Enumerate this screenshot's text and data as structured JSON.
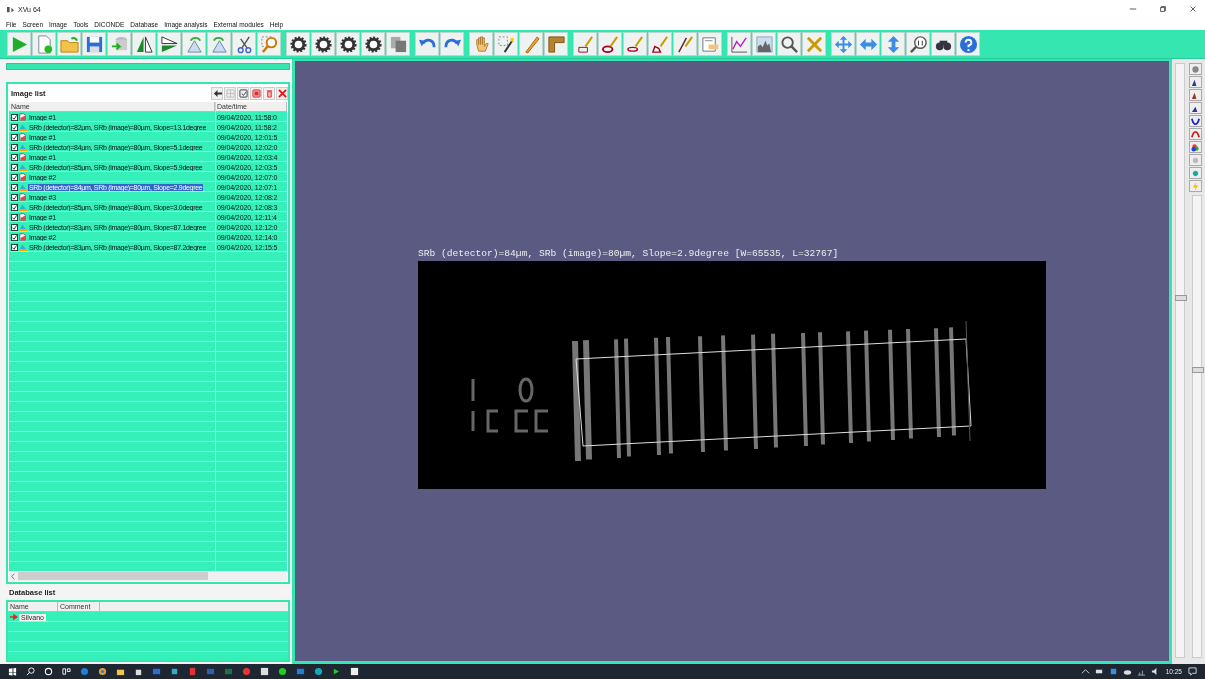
{
  "window": {
    "title": "XVu 64"
  },
  "menu": [
    "File",
    "Screen",
    "Image",
    "Tools",
    "DICONDE",
    "Database",
    "Image analysis",
    "External modules",
    "Help"
  ],
  "image_list": {
    "title": "Image list",
    "columns": [
      "Name",
      "Date/time"
    ],
    "rows": [
      {
        "kind": "image",
        "name": "Image #1",
        "date": "09/04/2020, 11:58:0",
        "checked": true,
        "selected": false
      },
      {
        "kind": "result",
        "name": "SRb (detector)=82µm, SRb (image)=80µm, Slope=13.1degree",
        "date": "09/04/2020, 11:58:2",
        "checked": true,
        "selected": false
      },
      {
        "kind": "image",
        "name": "Image #1",
        "date": "09/04/2020, 12:01:5",
        "checked": true,
        "selected": false
      },
      {
        "kind": "result",
        "name": "SRb (detector)=84µm, SRb (image)=80µm, Slope=5.1degree",
        "date": "09/04/2020, 12:02:0",
        "checked": true,
        "selected": false
      },
      {
        "kind": "image",
        "name": "Image #1",
        "date": "09/04/2020, 12:03:4",
        "checked": true,
        "selected": false
      },
      {
        "kind": "result",
        "name": "SRb (detector)=85µm, SRb (image)=80µm, Slope=5.9degree",
        "date": "09/04/2020, 12:03:5",
        "checked": true,
        "selected": false
      },
      {
        "kind": "image",
        "name": "Image #2",
        "date": "09/04/2020, 12:07:0",
        "checked": true,
        "selected": false
      },
      {
        "kind": "result",
        "name": "SRb (detector)=84µm, SRb (image)=80µm, Slope=2.9degree",
        "date": "09/04/2020, 12:07:1",
        "checked": true,
        "selected": true
      },
      {
        "kind": "image",
        "name": "Image #3",
        "date": "09/04/2020, 12:08:2",
        "checked": true,
        "selected": false
      },
      {
        "kind": "result",
        "name": "SRb (detector)=85µm, SRb (image)=80µm, Slope=3.0degree",
        "date": "09/04/2020, 12:08:3",
        "checked": true,
        "selected": false
      },
      {
        "kind": "image",
        "name": "Image #1",
        "date": "09/04/2020, 12:11:4",
        "checked": true,
        "selected": false
      },
      {
        "kind": "result",
        "name": "SRb (detector)=83µm, SRb (image)=80µm, Slope=87.1degree",
        "date": "09/04/2020, 12:12:0",
        "checked": true,
        "selected": false
      },
      {
        "kind": "image",
        "name": "Image #2",
        "date": "09/04/2020, 12:14:0",
        "checked": true,
        "selected": false
      },
      {
        "kind": "result",
        "name": "SRb (detector)=83µm, SRb (image)=80µm, Slope=87.2degree",
        "date": "09/04/2020, 12:15:5",
        "checked": true,
        "selected": false
      }
    ]
  },
  "canvas": {
    "caption": "SRb (detector)=84µm, SRb (image)=80µm, Slope=2.9degree [W=65535, L=32767]"
  },
  "database_list": {
    "title": "Database list",
    "columns": [
      "Name",
      "Comment"
    ],
    "rows": [
      {
        "name": "Silvano"
      }
    ]
  },
  "side_sliders": [
    {
      "level": 0.61
    },
    {
      "level": 0.63
    }
  ],
  "taskbar": {
    "clock": "10:25"
  }
}
